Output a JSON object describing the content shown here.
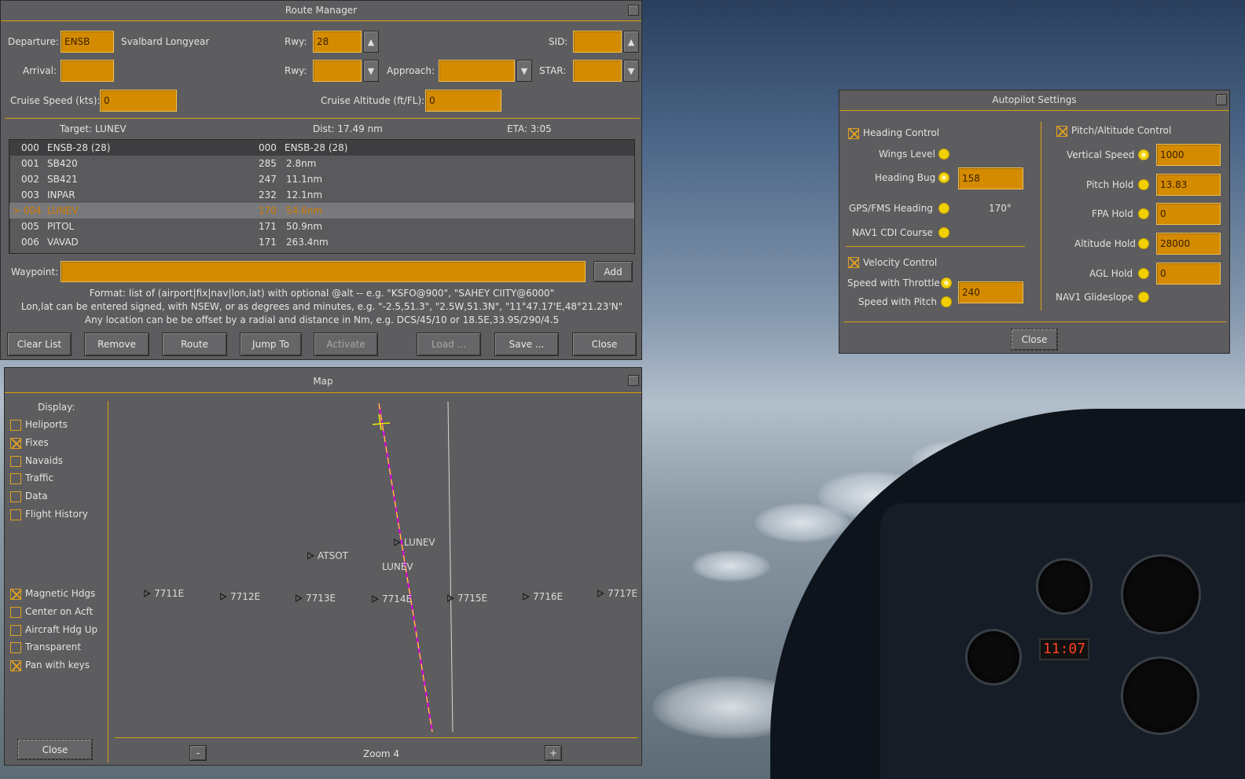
{
  "route_manager": {
    "title": "Route Manager",
    "departure_label": "Departure:",
    "departure_value": "ENSB",
    "departure_name": "Svalbard Longyear",
    "rwy_label": "Rwy:",
    "dep_rwy_value": "28",
    "sid_label": "SID:",
    "sid_value": "",
    "arrival_label": "Arrival:",
    "arrival_value": "",
    "arr_rwy_value": "",
    "approach_label": "Approach:",
    "approach_value": "",
    "star_label": "STAR:",
    "star_value": "",
    "cruise_speed_label": "Cruise Speed (kts):",
    "cruise_speed_value": "0",
    "cruise_alt_label": "Cruise Altitude (ft/FL):",
    "cruise_alt_value": "0",
    "target": "Target: LUNEV",
    "dist": "Dist: 17.49 nm",
    "eta": "ETA: 3:05",
    "waypoints": [
      {
        "idx": "000",
        "name": "ENSB-28 (28)",
        "hdg": "000",
        "dist": "ENSB-28 (28)"
      },
      {
        "idx": "001",
        "name": "SB420",
        "hdg": "285",
        "dist": "2.8nm"
      },
      {
        "idx": "002",
        "name": "SB421",
        "hdg": "247",
        "dist": "11.1nm"
      },
      {
        "idx": "003",
        "name": "INPAR",
        "hdg": "232",
        "dist": "12.1nm"
      },
      {
        "idx": "> 004",
        "name": "LUNEV",
        "hdg": "170",
        "dist": "54.6nm"
      },
      {
        "idx": "005",
        "name": "PITOL",
        "hdg": "171",
        "dist": "50.9nm"
      },
      {
        "idx": "006",
        "name": "VAVAD",
        "hdg": "171",
        "dist": "263.4nm"
      }
    ],
    "waypoint_label": "Waypoint:",
    "waypoint_value": "",
    "add_label": "Add",
    "help_1": "Format: list of (airport|fix|nav|lon,lat) with optional @alt -- e.g. \"KSFO@900\", \"SAHEY CIITY@6000\"",
    "help_2": "Lon,lat can be entered signed, with NSEW, or as degrees and minutes, e.g. \"-2.5,51.3\", \"2.5W,51.3N\", \"11°47.17'E,48°21.23'N\"",
    "help_3": "Any location can be be offset by a radial and distance in Nm, e.g. DCS/45/10 or 18.5E,33.9S/290/4.5",
    "buttons": {
      "clear": "Clear List",
      "remove": "Remove",
      "route": "Route",
      "jump": "Jump To",
      "activate": "Activate",
      "load": "Load ...",
      "save": "Save ...",
      "close": "Close"
    }
  },
  "map": {
    "title": "Map",
    "display_label": "Display:",
    "options_top": [
      {
        "label": "Heliports",
        "checked": false
      },
      {
        "label": "Fixes",
        "checked": true
      },
      {
        "label": "Navaids",
        "checked": false
      },
      {
        "label": "Traffic",
        "checked": false
      },
      {
        "label": "Data",
        "checked": false
      },
      {
        "label": "Flight History",
        "checked": false
      }
    ],
    "options_bottom": [
      {
        "label": "Magnetic Hdgs",
        "checked": true
      },
      {
        "label": "Center on Acft",
        "checked": false
      },
      {
        "label": "Aircraft Hdg Up",
        "checked": false
      },
      {
        "label": "Transparent",
        "checked": false
      },
      {
        "label": "Pan with keys",
        "checked": true
      }
    ],
    "fixes": [
      "ATSOT",
      "LUNEV",
      "7711E",
      "7712E",
      "7713E",
      "7714E",
      "7715E",
      "7716E",
      "7717E"
    ],
    "route_label": "LUNEV",
    "zoom_minus": "-",
    "zoom_label": "Zoom 4",
    "zoom_plus": "+",
    "close_label": "Close",
    "colors": {
      "route": "#e000e0",
      "track": "#f0f000",
      "field": "#d48b00"
    }
  },
  "autopilot": {
    "title": "Autopilot Settings",
    "heading_control": "Heading Control",
    "heading_checked": true,
    "wings_level": "Wings Level",
    "heading_bug": "Heading Bug",
    "heading_bug_value": "158",
    "gps_fms": "GPS/FMS Heading",
    "gps_fms_value": "170°",
    "nav1_cdi": "NAV1 CDI Course",
    "velocity_control": "Velocity Control",
    "velocity_checked": true,
    "speed_throttle": "Speed with Throttle",
    "speed_value": "240",
    "speed_pitch": "Speed with Pitch",
    "pitch_alt_control": "Pitch/Altitude Control",
    "pitch_alt_checked": true,
    "vertical_speed": "Vertical Speed",
    "vertical_speed_value": "1000",
    "pitch_hold": "Pitch Hold",
    "pitch_hold_value": "13.83",
    "fpa_hold": "FPA Hold",
    "fpa_hold_value": "0",
    "altitude_hold": "Altitude Hold",
    "altitude_hold_value": "28000",
    "agl_hold": "AGL Hold",
    "agl_hold_value": "0",
    "nav1_glideslope": "NAV1 Glideslope",
    "close_label": "Close"
  },
  "cockpit": {
    "clock": "11:07"
  }
}
